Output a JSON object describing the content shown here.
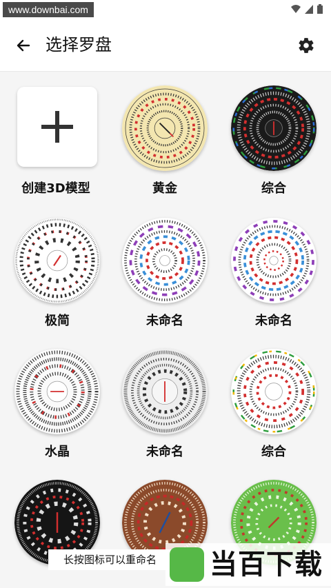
{
  "status": {
    "watermark": "www.downbai.com"
  },
  "app_bar": {
    "title": "选择罗盘"
  },
  "tiles": [
    {
      "label": "创建3D模型"
    },
    {
      "label": "黄金"
    },
    {
      "label": "综合"
    },
    {
      "label": "极简"
    },
    {
      "label": "未命名"
    },
    {
      "label": "未命名"
    },
    {
      "label": "水晶"
    },
    {
      "label": "未命名"
    },
    {
      "label": "综合"
    }
  ],
  "toast": {
    "text": "长按图标可以重命名"
  },
  "watermark_logo": {
    "text": "当百下载"
  },
  "colors": {
    "accent_red": "#d32f2f",
    "gold": "#f3e6b0",
    "wood": "#8b4a2b",
    "jade": "#6abf4b"
  }
}
